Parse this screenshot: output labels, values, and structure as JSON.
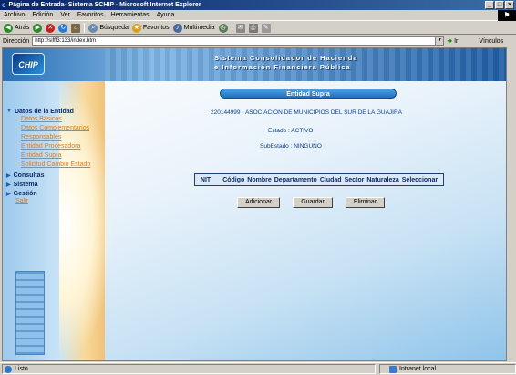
{
  "window": {
    "title": "Página de Entrada- Sistema SCHIP - Microsoft Internet Explorer"
  },
  "menu": [
    "Archivo",
    "Edición",
    "Ver",
    "Favoritos",
    "Herramientas",
    "Ayuda"
  ],
  "toolbar": {
    "back": "Atrás",
    "search": "Búsqueda",
    "favorites": "Favoritos",
    "media": "Multimedia"
  },
  "address": {
    "label": "Dirección",
    "url": "http://sifff3:133/index.htm",
    "go": "Ir",
    "links": "Vínculos"
  },
  "banner": {
    "line1": "Sistema Consolidador de Hacienda",
    "line2": "e Información Financiera Pública",
    "logo": "CHIP"
  },
  "nav": {
    "section_entity": "Datos de la Entidad",
    "subitems": [
      "Datos Básicos",
      "Datos Complementarios",
      "Responsables",
      "Entidad Procesadora",
      "Entidad Supra",
      "Solicitud Cambio Estado"
    ],
    "consultas": "Consultas",
    "sistema": "Sistema",
    "gestion": "Gestión",
    "salir": "Salir"
  },
  "panel": {
    "title": "Entidad Supra"
  },
  "entity": {
    "name": "220144999 - ASOCIACION DE MUNICIPIOS DEL SUR DE LA GUAJIRA",
    "estado": "Estado : ACTIVO",
    "subestado": "SubEstado : NINGUNO"
  },
  "table": {
    "columns": [
      "NIT",
      "Código",
      "Nombre",
      "Departamento",
      "Ciudad",
      "Sector",
      "Naturaleza",
      "Seleccionar"
    ]
  },
  "buttons": {
    "add": "Adicionar",
    "save": "Guardar",
    "delete": "Eliminar"
  },
  "status": {
    "left": "Listo",
    "zone": "Intranet local"
  }
}
